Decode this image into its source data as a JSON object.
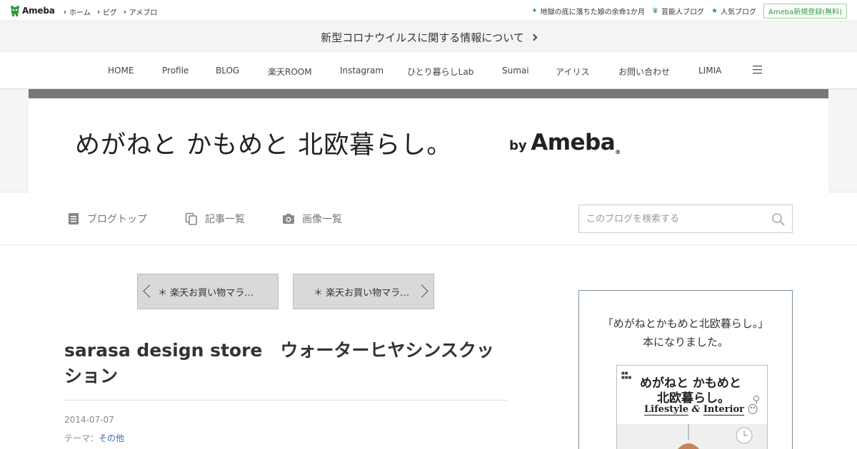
{
  "topbar": {
    "logo_text": "Ameba",
    "nav": [
      "ホーム",
      "ピグ",
      "アメブロ"
    ],
    "right_links": [
      {
        "icon": "sparkle-icon",
        "label": "地獄の底に落ちた娘の余命1か月"
      },
      {
        "icon": "crown-icon",
        "label": "芸能人ブログ"
      },
      {
        "icon": "star-icon",
        "label": "人気ブログ"
      }
    ],
    "register_label": "Ameba新規登録(無料)"
  },
  "banner": {
    "text": "新型コロナウイルスに関する情報について"
  },
  "main_nav": [
    "HOME",
    "Profile",
    "BLOG",
    "楽天ROOM",
    "Instagram",
    "ひとり暮らしLab",
    "Sumai",
    "アイリス",
    "お問い合わせ",
    "LIMIA"
  ],
  "header": {
    "blog_title": "めがねと かもめと 北欧暮らし。",
    "by_label": "by",
    "ameba_label": "Ameba",
    "reg_mark": "®"
  },
  "sub_nav": {
    "items": [
      {
        "icon": "document-icon",
        "label": "ブログトップ"
      },
      {
        "icon": "copy-icon",
        "label": "記事一覧"
      },
      {
        "icon": "camera-icon",
        "label": "画像一覧"
      }
    ],
    "search_placeholder": "このブログを検索する"
  },
  "pager": {
    "prev_label": "＊ 楽天お買い物マラ…",
    "next_label": "＊ 楽天お買い物マラ…"
  },
  "article": {
    "title": "sarasa design store　ウォーターヒヤシンスクッション",
    "date": "2014-07-07",
    "theme_label": "テーマ：",
    "theme_value": "その他"
  },
  "sidebar": {
    "line1": "「めがねとかもめと北欧暮らし。」",
    "line2": "本になりました。",
    "book": {
      "title_line1": "めがねと かもめと",
      "title_line2": "北欧暮らし。",
      "subtitle_a": "Lifestyle",
      "subtitle_amp": "&",
      "subtitle_b": "Interior"
    }
  },
  "colors": {
    "accent_green": "#2f9a3d",
    "link_blue": "#3a6fb5",
    "header_stripe": "#777777"
  }
}
